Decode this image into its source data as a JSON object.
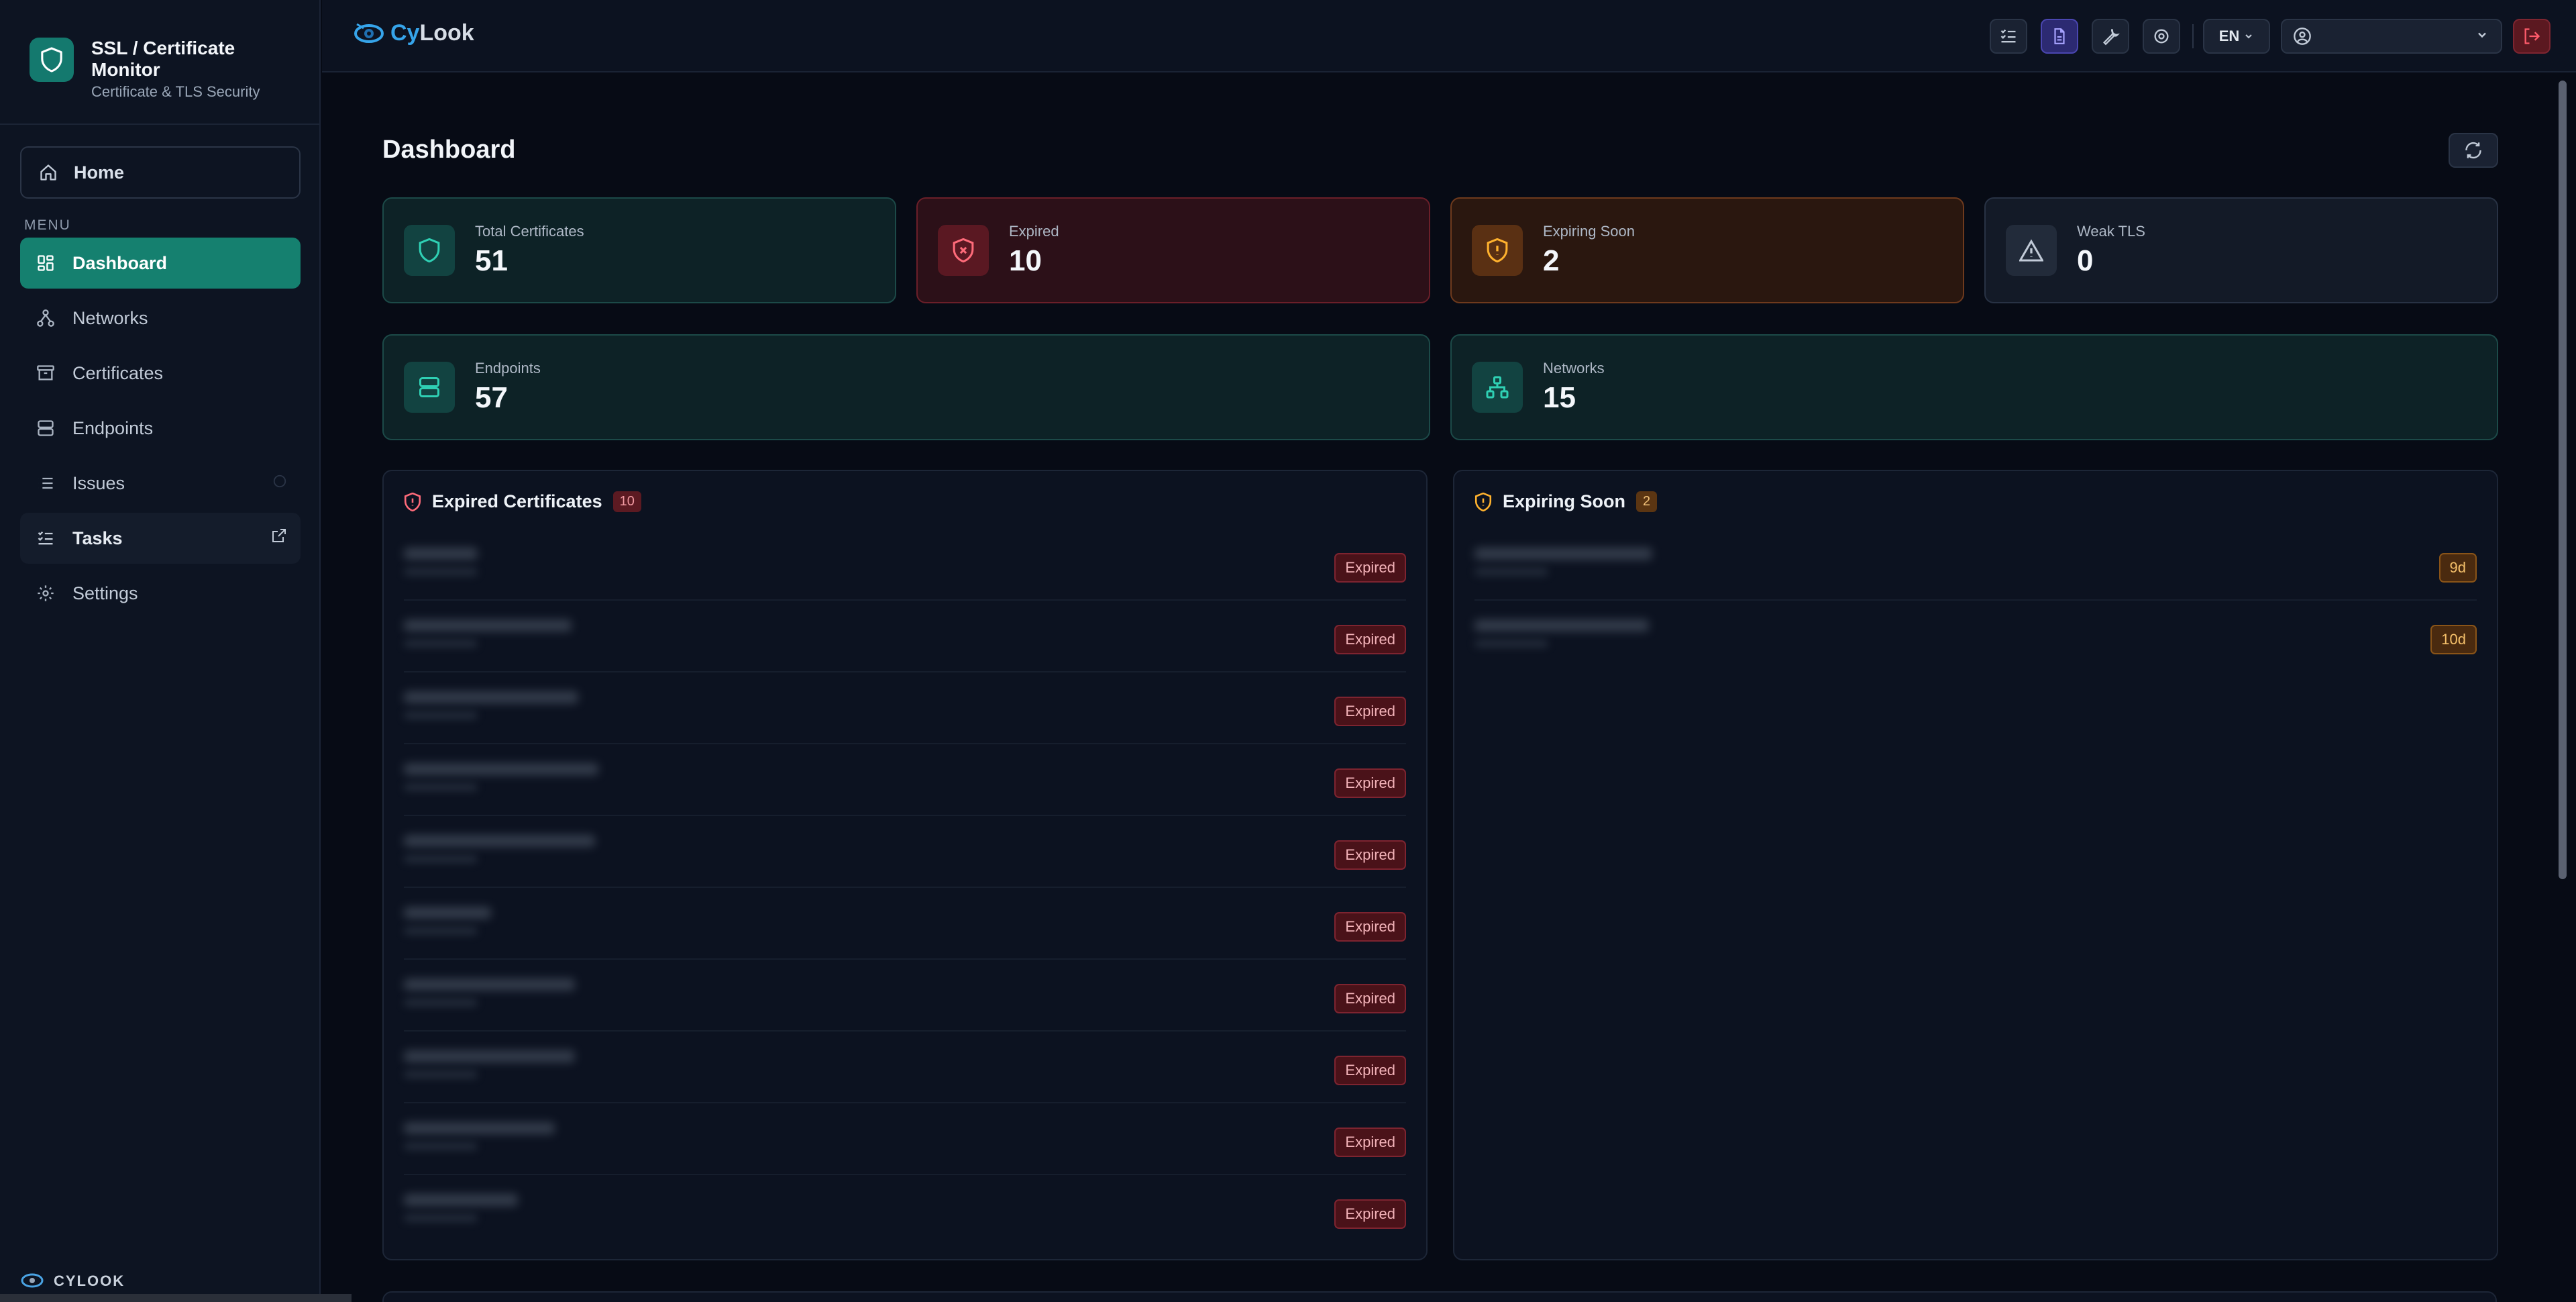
{
  "brand": {
    "title": "SSL / Certificate Monitor",
    "subtitle": "Certificate & TLS Security"
  },
  "sidebar": {
    "home_label": "Home",
    "menu_label": "MENU",
    "items": [
      {
        "label": "Dashboard",
        "icon": "dashboard-icon",
        "active": true
      },
      {
        "label": "Networks",
        "icon": "network-icon"
      },
      {
        "label": "Certificates",
        "icon": "archive-icon"
      },
      {
        "label": "Endpoints",
        "icon": "server-icon"
      },
      {
        "label": "Issues",
        "icon": "list-icon"
      },
      {
        "label": "Tasks",
        "icon": "tasks-icon",
        "external": true
      },
      {
        "label": "Settings",
        "icon": "gear-icon"
      }
    ],
    "footer": "CYLOOK"
  },
  "topbar": {
    "logo_cy": "Cy",
    "logo_look": "Look",
    "language": "EN"
  },
  "page": {
    "title": "Dashboard"
  },
  "stats": {
    "total_certificates": {
      "label": "Total Certificates",
      "value": "51"
    },
    "expired": {
      "label": "Expired",
      "value": "10"
    },
    "expiring_soon": {
      "label": "Expiring Soon",
      "value": "2"
    },
    "weak_tls": {
      "label": "Weak TLS",
      "value": "0"
    },
    "endpoints": {
      "label": "Endpoints",
      "value": "57"
    },
    "networks": {
      "label": "Networks",
      "value": "15"
    }
  },
  "expired_panel": {
    "title": "Expired Certificates",
    "count": "10",
    "rows": [
      {
        "status": "Expired"
      },
      {
        "status": "Expired"
      },
      {
        "status": "Expired"
      },
      {
        "status": "Expired"
      },
      {
        "status": "Expired"
      },
      {
        "status": "Expired"
      },
      {
        "status": "Expired"
      },
      {
        "status": "Expired"
      },
      {
        "status": "Expired"
      },
      {
        "status": "Expired"
      }
    ]
  },
  "expiring_panel": {
    "title": "Expiring Soon",
    "count": "2",
    "rows": [
      {
        "days": "9d"
      },
      {
        "days": "10d"
      }
    ]
  },
  "colors": {
    "accent": "#15806f",
    "danger": "#7e2430",
    "warning": "#8a5418",
    "background": "#070b15"
  }
}
